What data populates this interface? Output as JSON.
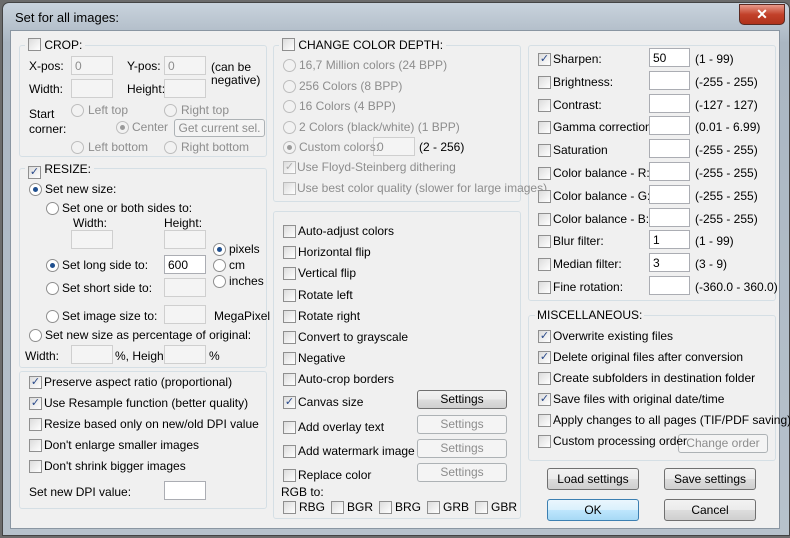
{
  "window": {
    "title": "Set for all images:",
    "close_glyph": "✕"
  },
  "crop": {
    "label": "CROP:",
    "xpos_label": "X-pos:",
    "xpos": "0",
    "ypos_label": "Y-pos:",
    "ypos": "0",
    "note": "(can be negative)",
    "width_label": "Width:",
    "height_label": "Height:",
    "start_label": "Start corner:",
    "left_top": "Left top",
    "right_top": "Right top",
    "center": "Center",
    "left_bottom": "Left bottom",
    "right_bottom": "Right bottom",
    "get_sel": "Get current sel."
  },
  "resize": {
    "label": "RESIZE:",
    "set_new_size": "Set new size:",
    "one_or_both": "Set one or both sides to:",
    "width_label": "Width:",
    "height_label": "Height:",
    "pixels": "pixels",
    "cm": "cm",
    "inches": "inches",
    "long_side": "Set long side to:",
    "long_value": "600",
    "short_side": "Set short side to:",
    "image_size": "Set image size to:",
    "megapixel": "MegaPixel",
    "percentage": "Set new size as percentage of original:",
    "pct_width": "Width:",
    "pct_unit1": "%, Height:",
    "pct_unit2": "%"
  },
  "options": {
    "items": [
      "Preserve aspect ratio (proportional)",
      "Use Resample function (better quality)",
      "Resize based only on new/old DPI value",
      "Don't enlarge smaller images",
      "Don't shrink bigger images"
    ],
    "checked": [
      true,
      true,
      false,
      false,
      false
    ],
    "dpi_label": "Set new DPI value:"
  },
  "color_depth": {
    "label": "CHANGE COLOR DEPTH:",
    "options": [
      "16,7 Million colors (24 BPP)",
      "256 Colors (8 BPP)",
      "16 Colors (4 BPP)",
      "2 Colors (black/white) (1 BPP)",
      "Custom colors:"
    ],
    "custom_value": "0",
    "custom_range": "(2 - 256)",
    "dither": "Use Floyd-Steinberg dithering",
    "best": "Use best color quality (slower for large images)"
  },
  "effects": {
    "items": [
      "Auto-adjust colors",
      "Horizontal flip",
      "Vertical flip",
      "Rotate left",
      "Rotate right",
      "Convert to grayscale",
      "Negative",
      "Auto-crop borders",
      "Canvas size",
      "Add overlay text",
      "Add watermark image",
      "Replace color"
    ],
    "checked": [
      false,
      false,
      false,
      false,
      false,
      false,
      false,
      false,
      true,
      false,
      false,
      false
    ],
    "settings": "Settings",
    "rgb_label": "RGB to:",
    "rgb": [
      "RBG",
      "BGR",
      "BRG",
      "GRB",
      "GBR"
    ]
  },
  "filters": {
    "items": [
      {
        "label": "Sharpen:",
        "value": "50",
        "range": "(1  -  99)",
        "checked": true
      },
      {
        "label": "Brightness:",
        "value": "",
        "range": "(-255  -  255)",
        "checked": false
      },
      {
        "label": "Contrast:",
        "value": "",
        "range": "(-127  -  127)",
        "checked": false
      },
      {
        "label": "Gamma correction:",
        "value": "",
        "range": "(0.01  -  6.99)",
        "checked": false
      },
      {
        "label": "Saturation",
        "value": "",
        "range": "(-255  -  255)",
        "checked": false
      },
      {
        "label": "Color balance - R:",
        "value": "",
        "range": "(-255  -  255)",
        "checked": false
      },
      {
        "label": "Color balance - G:",
        "value": "",
        "range": "(-255  -  255)",
        "checked": false
      },
      {
        "label": "Color balance - B:",
        "value": "",
        "range": "(-255  -  255)",
        "checked": false
      },
      {
        "label": "Blur filter:",
        "value": "1",
        "range": "(1  -  99)",
        "checked": false
      },
      {
        "label": "Median filter:",
        "value": "3",
        "range": "(3  -  9)",
        "checked": false
      },
      {
        "label": "Fine rotation:",
        "value": "",
        "range": "(-360.0  -  360.0)",
        "checked": false
      }
    ]
  },
  "misc": {
    "label": "MISCELLANEOUS:",
    "items": [
      "Overwrite existing files",
      "Delete original files after conversion",
      "Create subfolders in destination folder",
      "Save files with original date/time",
      "Apply changes to all pages (TIF/PDF saving)",
      "Custom processing order"
    ],
    "checked": [
      true,
      true,
      false,
      true,
      false,
      false
    ],
    "change_order": "Change order"
  },
  "buttons": {
    "load": "Load settings",
    "save": "Save settings",
    "ok": "OK",
    "cancel": "Cancel"
  }
}
